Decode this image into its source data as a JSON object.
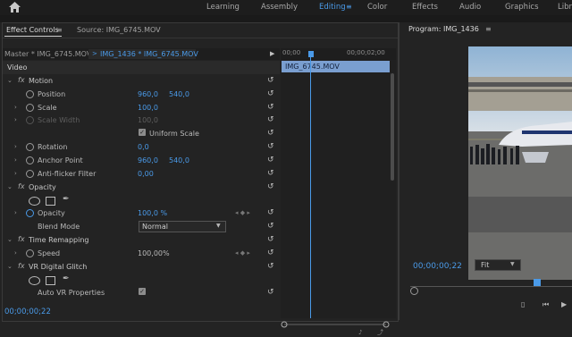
{
  "topbar": {
    "workspaces": [
      "Learning",
      "Assembly",
      "Editing",
      "Color",
      "Effects",
      "Audio",
      "Graphics",
      "Libr"
    ],
    "active_workspace": "Editing",
    "menu_icon": "≡"
  },
  "effect_controls": {
    "tabs": [
      "Effect Controls",
      "Source: IMG_6745.MOV"
    ],
    "tab_menu": "≡",
    "master_label": "Master * IMG_6745.MOV",
    "clip_label": "IMG_1436 * IMG_6745.MOV",
    "rows": [
      {
        "type": "section",
        "label": "Video"
      },
      {
        "type": "effect",
        "label": "Motion"
      },
      {
        "type": "prop",
        "label": "Position",
        "v1": "960,0",
        "v2": "540,0"
      },
      {
        "type": "prop",
        "label": "Scale",
        "v1": "100,0"
      },
      {
        "type": "prop",
        "label": "Scale Width",
        "v1": "100,0",
        "disabled": true
      },
      {
        "type": "check",
        "label": "Uniform Scale"
      },
      {
        "type": "prop",
        "label": "Rotation",
        "v1": "0,0"
      },
      {
        "type": "prop",
        "label": "Anchor Point",
        "v1": "960,0",
        "v2": "540,0"
      },
      {
        "type": "prop",
        "label": "Anti-flicker Filter",
        "v1": "0,00"
      },
      {
        "type": "effect",
        "label": "Opacity"
      },
      {
        "type": "masks",
        "label": ""
      },
      {
        "type": "prop",
        "label": "Opacity",
        "v1": "100,0 %"
      },
      {
        "type": "select",
        "label": "Blend Mode",
        "value": "Normal"
      },
      {
        "type": "effect",
        "label": "Time Remapping"
      },
      {
        "type": "prop",
        "label": "Speed",
        "v1": "100,00%"
      },
      {
        "type": "effect",
        "label": "VR Digital Glitch"
      },
      {
        "type": "masks",
        "label": ""
      },
      {
        "type": "check",
        "label": "Auto VR Properties"
      }
    ],
    "timeline": {
      "ruler_start": "00;00",
      "ruler_end": "00;00;02;00",
      "clip_name": "IMG_6745.MOV"
    },
    "timecode": "00;00;00;22"
  },
  "program": {
    "title": "Program: IMG_1436",
    "menu": "≡",
    "timecode": "00;00;00;22",
    "zoom": "Fit"
  },
  "colors": {
    "accent": "#4a9ae8",
    "panel": "#232323",
    "clip": "#7a9fd0"
  }
}
